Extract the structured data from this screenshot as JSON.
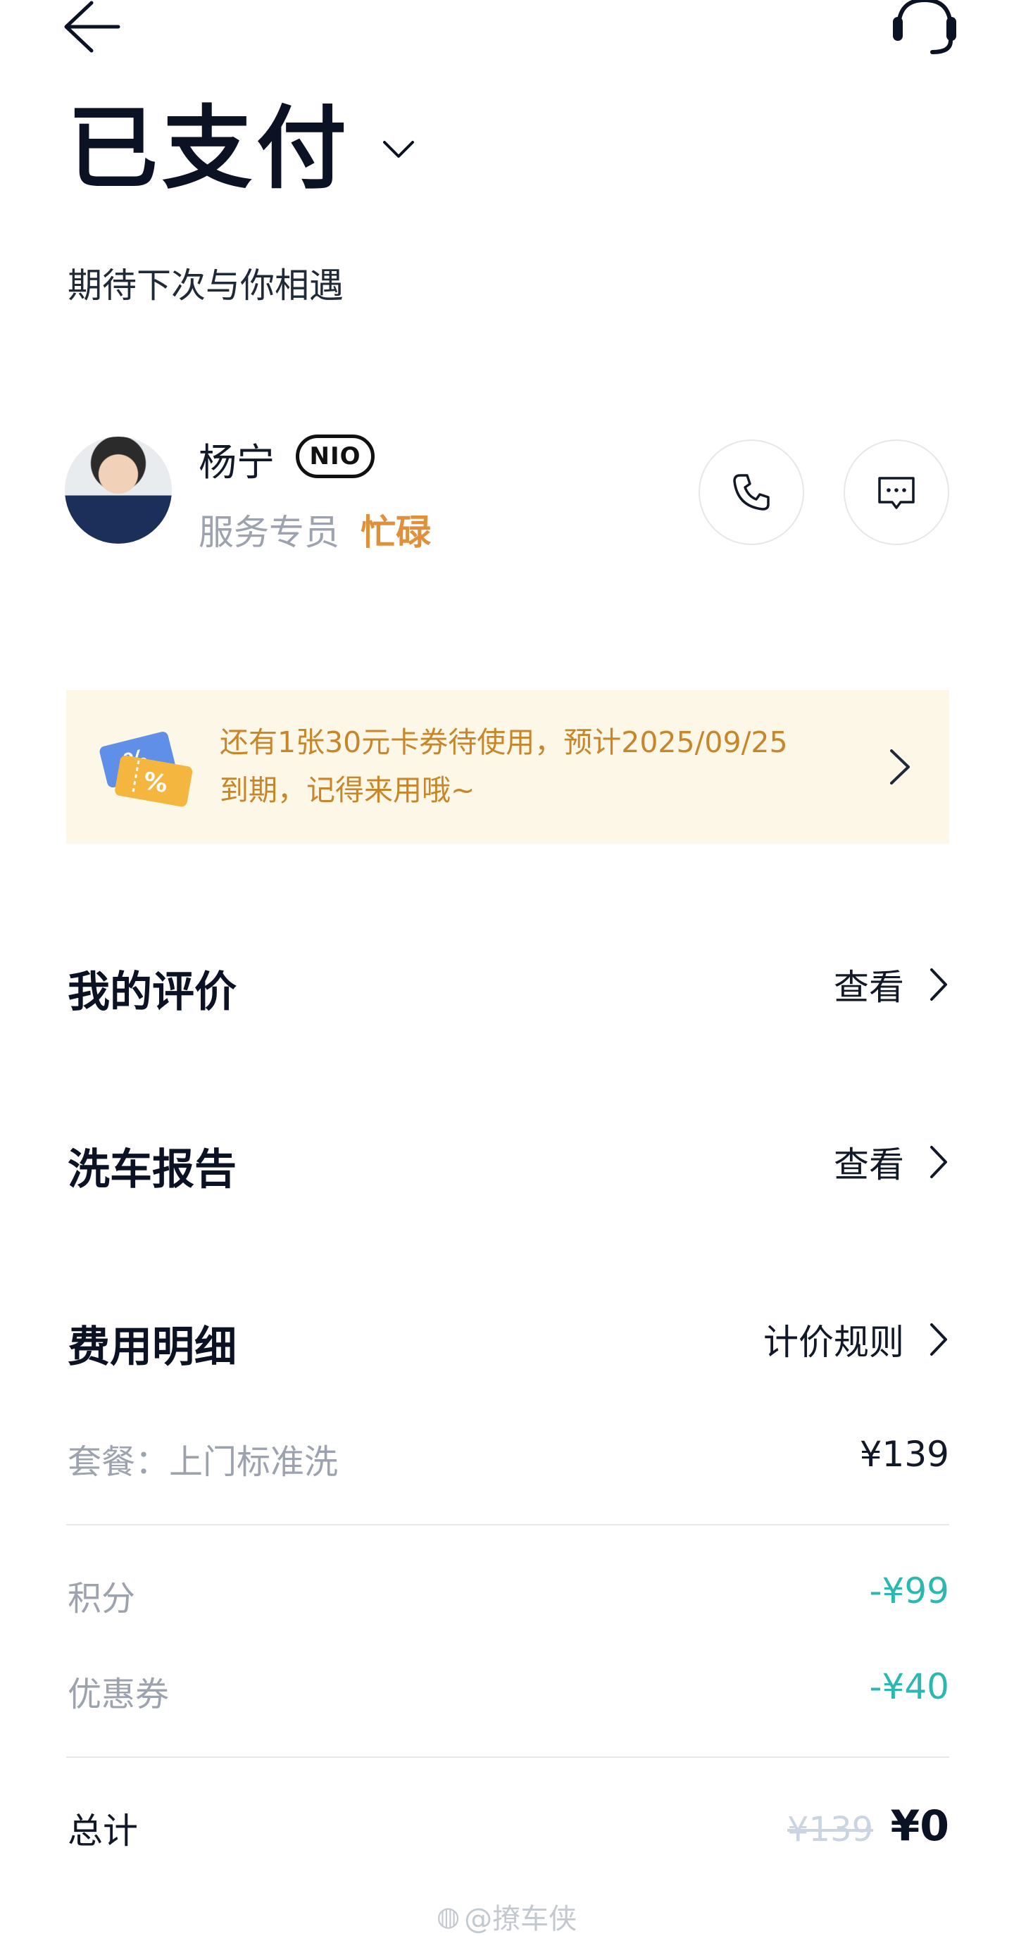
{
  "header": {
    "back_icon": "arrow-left-icon",
    "support_icon": "headset-icon"
  },
  "status": {
    "title": "已支付",
    "subtitle": "期待下次与你相遇"
  },
  "agent": {
    "name": "杨宁",
    "badge": "NIO",
    "role": "服务专员",
    "status": "忙碌",
    "call_icon": "phone-icon",
    "message_icon": "chat-icon"
  },
  "coupon_banner": {
    "line1": "还有1张30元卡券待使用，预计2025/09/25",
    "line2": "到期，记得来用哦~"
  },
  "sections": {
    "review": {
      "title": "我的评价",
      "link": "查看"
    },
    "wash_report": {
      "title": "洗车报告",
      "link": "查看"
    },
    "fees": {
      "title": "费用明细",
      "link": "计价规则"
    }
  },
  "fees": {
    "package_label": "套餐：上门标准洗",
    "package_value": "¥139",
    "points_label": "积分",
    "points_value": "-¥99",
    "coupon_label": "优惠券",
    "coupon_value": "-¥40",
    "total_label": "总计",
    "total_original": "¥139",
    "total_final": "¥0"
  },
  "watermark": "@撩车侠",
  "colors": {
    "accent_orange": "#e0903a",
    "banner_bg": "#fdf7e8",
    "banner_text": "#c8862b",
    "discount_teal": "#2bb8b0"
  }
}
